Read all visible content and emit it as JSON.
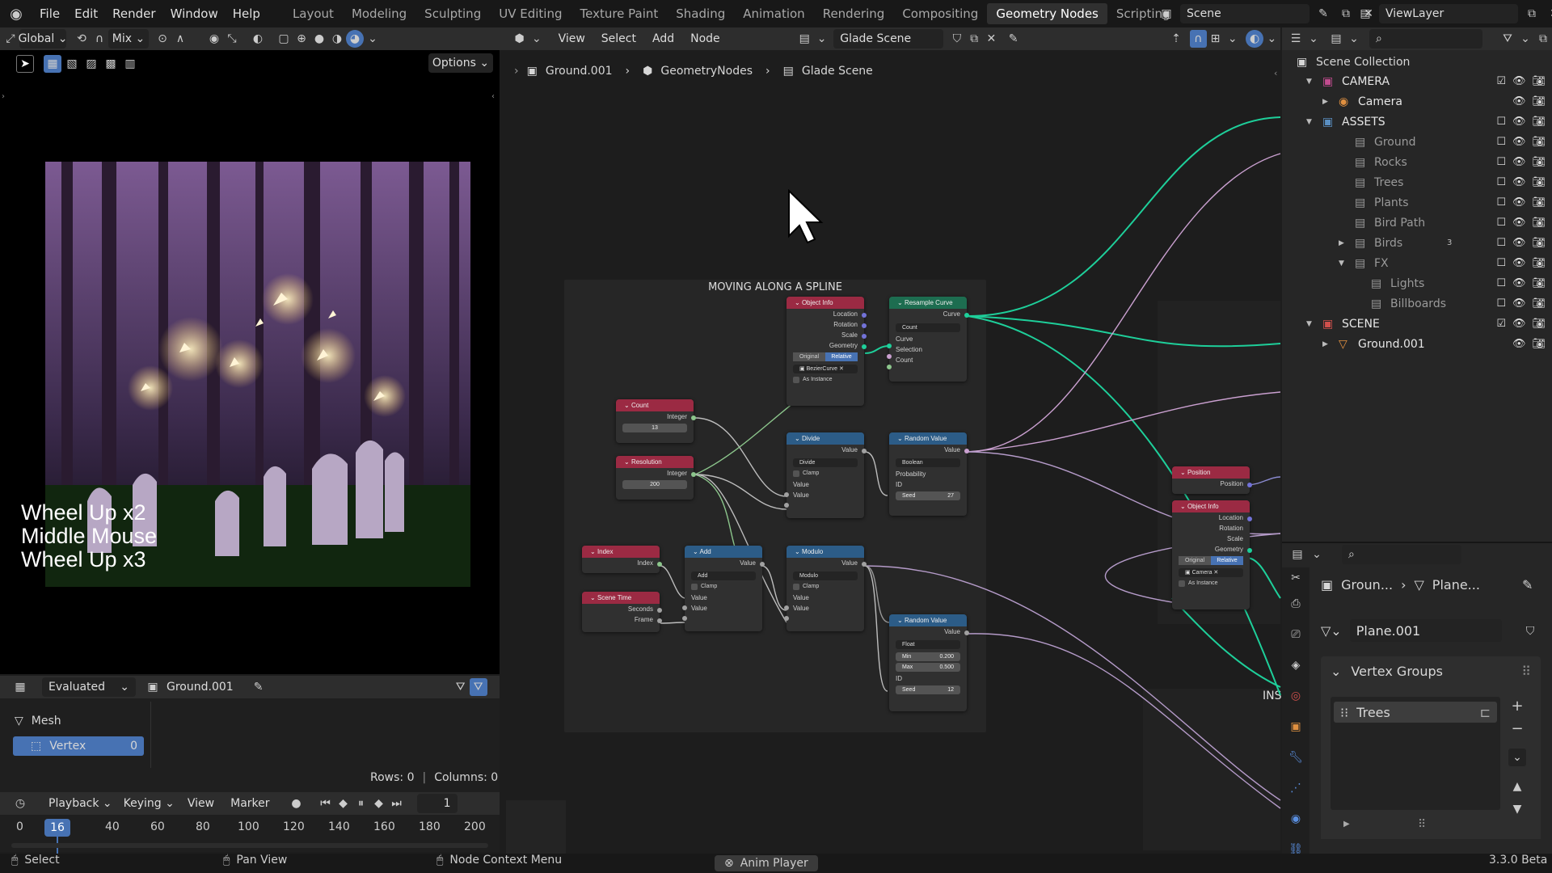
{
  "menu": {
    "items": [
      "File",
      "Edit",
      "Render",
      "Window",
      "Help"
    ],
    "workspaces": [
      "Layout",
      "Modeling",
      "Sculpting",
      "UV Editing",
      "Texture Paint",
      "Shading",
      "Animation",
      "Rendering",
      "Compositing",
      "Geometry Nodes",
      "Scripting"
    ],
    "active_workspace": "Geometry Nodes",
    "add_tab": "+",
    "scene": "Scene",
    "view_layer": "ViewLayer"
  },
  "viewport": {
    "orientation": "Global",
    "pivot": "Mix",
    "options": "Options",
    "overlay_text": [
      "Wheel Up x2",
      "Middle Mouse",
      "Wheel Up x3"
    ]
  },
  "node_editor": {
    "menus": [
      "View",
      "Select",
      "Add",
      "Node"
    ],
    "tree_name": "Glade Scene",
    "breadcrumb": [
      "Ground.001",
      "GeometryNodes",
      "Glade Scene"
    ],
    "frame_label": "MOVING ALONG A SPLINE",
    "partial_label": "INS"
  },
  "nodes": {
    "object_info": {
      "title": "Object Info",
      "outputs": [
        "Location",
        "Rotation",
        "Scale",
        "Geometry"
      ],
      "seg": [
        "Original",
        "Relative"
      ],
      "object": "BezierCurve",
      "as_instance": "As Instance"
    },
    "resample": {
      "title": "Resample Curve",
      "out": "Curve",
      "mode": "Count",
      "inputs": [
        "Curve",
        "Selection",
        "Count"
      ]
    },
    "count": {
      "title": "Count",
      "out": "Integer",
      "value": "13"
    },
    "resolution": {
      "title": "Resolution",
      "out": "Integer",
      "value": "200"
    },
    "divide": {
      "title": "Divide",
      "out": "Value",
      "op": "Divide",
      "clamp": "Clamp",
      "inputs": [
        "Value",
        "Value"
      ]
    },
    "random1": {
      "title": "Random Value",
      "out": "Value",
      "type": "Boolean",
      "inputs": [
        "Probability",
        "ID"
      ],
      "seed_label": "Seed",
      "seed": "27"
    },
    "index": {
      "title": "Index",
      "out": "Index"
    },
    "scene_time": {
      "title": "Scene Time",
      "outputs": [
        "Seconds",
        "Frame"
      ]
    },
    "add": {
      "title": "Add",
      "out": "Value",
      "op": "Add",
      "clamp": "Clamp",
      "inputs": [
        "Value",
        "Value"
      ]
    },
    "modulo": {
      "title": "Modulo",
      "out": "Value",
      "op": "Modulo",
      "clamp": "Clamp",
      "inputs": [
        "Value",
        "Value"
      ]
    },
    "random2": {
      "title": "Random Value",
      "out": "Value",
      "type": "Float",
      "min_label": "Min",
      "min": "0.200",
      "max_label": "Max",
      "max": "0.500",
      "id": "ID",
      "seed_label": "Seed",
      "seed": "12"
    },
    "position": {
      "title": "Position",
      "out": "Position"
    },
    "object_info2": {
      "title": "Object Info",
      "outputs": [
        "Location",
        "Rotation",
        "Scale",
        "Geometry"
      ],
      "seg": [
        "Original",
        "Relative"
      ],
      "object": "Camera",
      "as_instance": "As Instance"
    }
  },
  "spreadsheet": {
    "mode": "Evaluated",
    "object": "Ground.001",
    "tree": [
      "Mesh",
      "Vertex"
    ],
    "vertex_count": "0",
    "rows": "Rows: 0",
    "columns": "Columns: 0"
  },
  "timeline": {
    "menus": [
      "Playback",
      "Keying",
      "View",
      "Marker"
    ],
    "current_frame": "16",
    "frame_field": "1",
    "ticks": [
      "0",
      "40",
      "60",
      "80",
      "100",
      "120",
      "140",
      "160",
      "180",
      "200"
    ]
  },
  "outliner": {
    "title": "Scene Collection",
    "items": [
      {
        "name": "CAMERA",
        "kind": "collection",
        "color": "#c24c8f"
      },
      {
        "name": "Camera",
        "kind": "camera"
      },
      {
        "name": "ASSETS",
        "kind": "collection",
        "color": "#5a8fc2"
      },
      {
        "name": "Ground",
        "kind": "sub"
      },
      {
        "name": "Rocks",
        "kind": "sub"
      },
      {
        "name": "Trees",
        "kind": "sub"
      },
      {
        "name": "Plants",
        "kind": "sub"
      },
      {
        "name": "Bird Path",
        "kind": "sub"
      },
      {
        "name": "Birds",
        "kind": "sub",
        "badge": "3"
      },
      {
        "name": "FX",
        "kind": "sub"
      },
      {
        "name": "Lights",
        "kind": "sub2"
      },
      {
        "name": "Billboards",
        "kind": "sub2"
      },
      {
        "name": "SCENE",
        "kind": "collection",
        "color": "#d0504c"
      },
      {
        "name": "Ground.001",
        "kind": "object"
      }
    ]
  },
  "properties": {
    "crumb_object": "Groun...",
    "crumb_data": "Plane...",
    "data_name": "Plane.001",
    "panel": "Vertex Groups",
    "group": "Trees"
  },
  "status": {
    "select": "Select",
    "pan": "Pan View",
    "context": "Node Context Menu",
    "anim": "Anim Player",
    "version": "3.3.0 Beta"
  }
}
